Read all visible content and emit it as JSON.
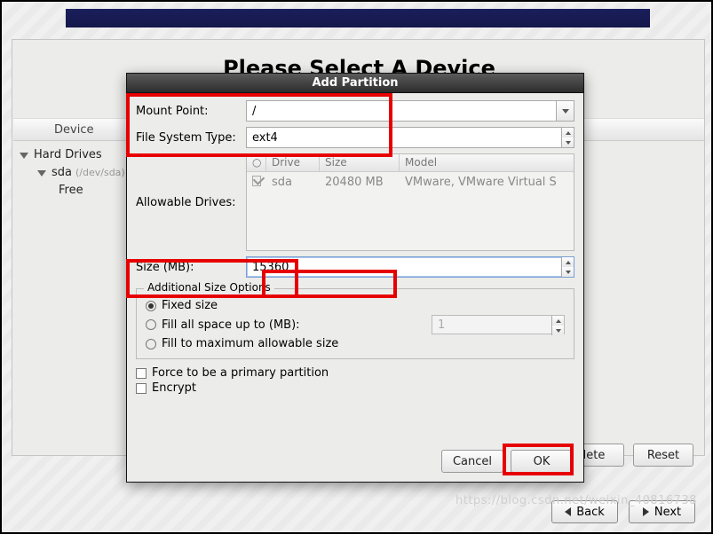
{
  "page_title": "Please Select A Device",
  "device_header": "Device",
  "tree": {
    "hard_drives": "Hard Drives",
    "sda": "sda",
    "sda_dev": "(/dev/sda)",
    "free": "Free"
  },
  "dialog": {
    "title": "Add Partition",
    "mount_label": "Mount Point:",
    "mount_value": "/",
    "fs_label": "File System Type:",
    "fs_value": "ext4",
    "drives_label": "Allowable Drives:",
    "drive_head": {
      "c1": "Drive",
      "c2": "Size",
      "c3": "Model"
    },
    "drive_row": {
      "name": "sda",
      "size": "20480 MB",
      "model": "VMware, VMware Virtual S"
    },
    "size_label": "Size (MB):",
    "size_value": "15360",
    "fieldset_title": "Additional Size Options",
    "opt_fixed": "Fixed size",
    "opt_fill_up": "Fill all space up to (MB):",
    "opt_fill_up_value": "1",
    "opt_fill_max": "Fill to maximum allowable size",
    "force_primary": "Force to be a primary partition",
    "encrypt": "Encrypt",
    "cancel": "Cancel",
    "ok": "OK"
  },
  "panel_buttons": {
    "delete": "lete",
    "reset": "Reset"
  },
  "nav": {
    "back": "Back",
    "next": "Next"
  },
  "watermark": "https://blog.csdn.net/weixin_40816738"
}
